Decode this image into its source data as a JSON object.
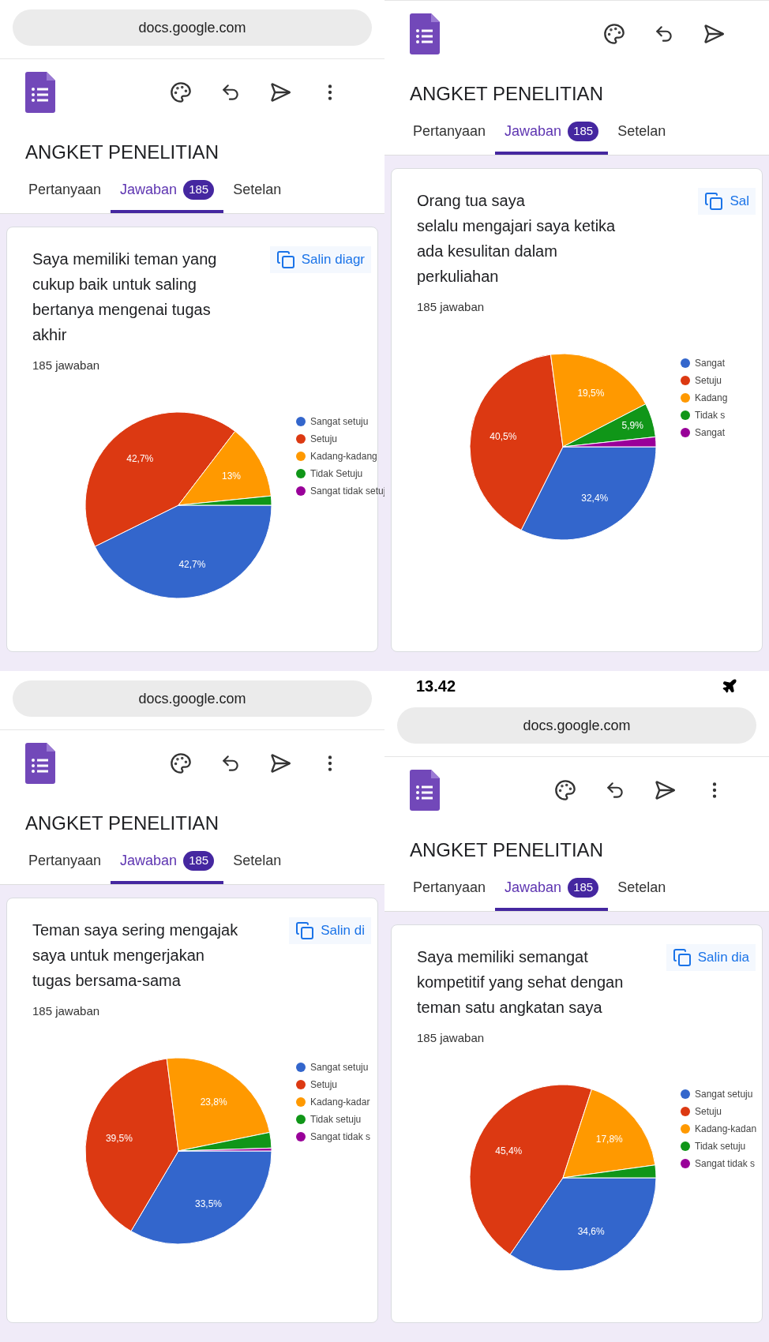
{
  "panels": [
    {
      "url": "docs.google.com",
      "toolbar_more": true,
      "form_title": "ANGKET PENELITIAN",
      "tabs": [
        {
          "label": "Pertanyaan",
          "selected": false
        },
        {
          "label": "Jawaban",
          "badge": "185",
          "selected": true
        },
        {
          "label": "Setelan",
          "selected": false
        }
      ],
      "question": "Saya memiliki teman yang cukup baik untuk saling bertanya mengenai tugas akhir",
      "responses": "185 jawaban",
      "copy_button": "Salin diagr",
      "chart_data": {
        "type": "pie",
        "categories": [
          "Sangat setuju",
          "Setuju",
          "Kadang-kadang",
          "Tidak Setuju",
          "Sangat tidak setuj"
        ],
        "legend": "right",
        "series": [
          {
            "colors": [
              "#3366cc",
              "#dc3912",
              "#ff9900",
              "#109618",
              "#990099"
            ],
            "values": [
              42.7,
              42.7,
              13,
              1.6,
              0
            ],
            "value_labels": [
              "42,7%",
              "42,7%",
              "13%",
              null,
              null
            ]
          }
        ]
      }
    },
    {
      "toolbar_more": false,
      "form_title": "ANGKET PENELITIAN",
      "tabs": [
        {
          "label": "Pertanyaan",
          "selected": false
        },
        {
          "label": "Jawaban",
          "badge": "185",
          "selected": true
        },
        {
          "label": "Setelan",
          "selected": false
        }
      ],
      "question": "Orang tua saya\nselalu mengajari saya ketika ada kesulitan dalam perkuliahan",
      "responses": "185 jawaban",
      "copy_button": "Sal",
      "chart_data": {
        "type": "pie",
        "categories": [
          "Sangat",
          "Setuju",
          "Kadang",
          "Tidak s",
          "Sangat"
        ],
        "legend": "right",
        "series": [
          {
            "colors": [
              "#3366cc",
              "#dc3912",
              "#ff9900",
              "#109618",
              "#990099"
            ],
            "values": [
              32.4,
              40.5,
              19.5,
              5.9,
              1.7
            ],
            "value_labels": [
              "32,4%",
              "40,5%",
              "19,5%",
              "5,9%",
              null
            ]
          }
        ]
      }
    },
    {
      "url": "docs.google.com",
      "toolbar_more": true,
      "form_title": "ANGKET PENELITIAN",
      "tabs": [
        {
          "label": "Pertanyaan",
          "selected": false
        },
        {
          "label": "Jawaban",
          "badge": "185",
          "selected": true
        },
        {
          "label": "Setelan",
          "selected": false
        }
      ],
      "question": "Teman saya sering mengajak saya untuk mengerjakan tugas bersama-sama",
      "responses": "185 jawaban",
      "copy_button": "Salin di",
      "chart_data": {
        "type": "pie",
        "categories": [
          "Sangat setuju",
          "Setuju",
          "Kadang-kadar",
          "Tidak setuju",
          "Sangat tidak s"
        ],
        "legend": "right",
        "series": [
          {
            "colors": [
              "#3366cc",
              "#dc3912",
              "#ff9900",
              "#109618",
              "#990099"
            ],
            "values": [
              33.5,
              39.5,
              23.8,
              2.7,
              0.5
            ],
            "value_labels": [
              "33,5%",
              "39,5%",
              "23,8%",
              null,
              null
            ]
          }
        ]
      }
    },
    {
      "status_time": "13.42",
      "url": "docs.google.com",
      "toolbar_more": true,
      "form_title": "ANGKET PENELITIAN",
      "tabs": [
        {
          "label": "Pertanyaan",
          "selected": false
        },
        {
          "label": "Jawaban",
          "badge": "185",
          "selected": true
        },
        {
          "label": "Setelan",
          "selected": false
        }
      ],
      "question": "Saya memiliki semangat kompetitif yang sehat dengan teman satu angkatan saya",
      "responses": "185 jawaban",
      "copy_button": "Salin dia",
      "chart_data": {
        "type": "pie",
        "categories": [
          "Sangat setuju",
          "Setuju",
          "Kadang-kadan",
          "Tidak setuju",
          "Sangat tidak s"
        ],
        "legend": "right",
        "series": [
          {
            "colors": [
              "#3366cc",
              "#dc3912",
              "#ff9900",
              "#109618",
              "#990099"
            ],
            "values": [
              34.6,
              45.4,
              17.8,
              2.2,
              0
            ],
            "value_labels": [
              "34,6%",
              "45,4%",
              "17,8%",
              null,
              null
            ]
          }
        ]
      }
    }
  ]
}
